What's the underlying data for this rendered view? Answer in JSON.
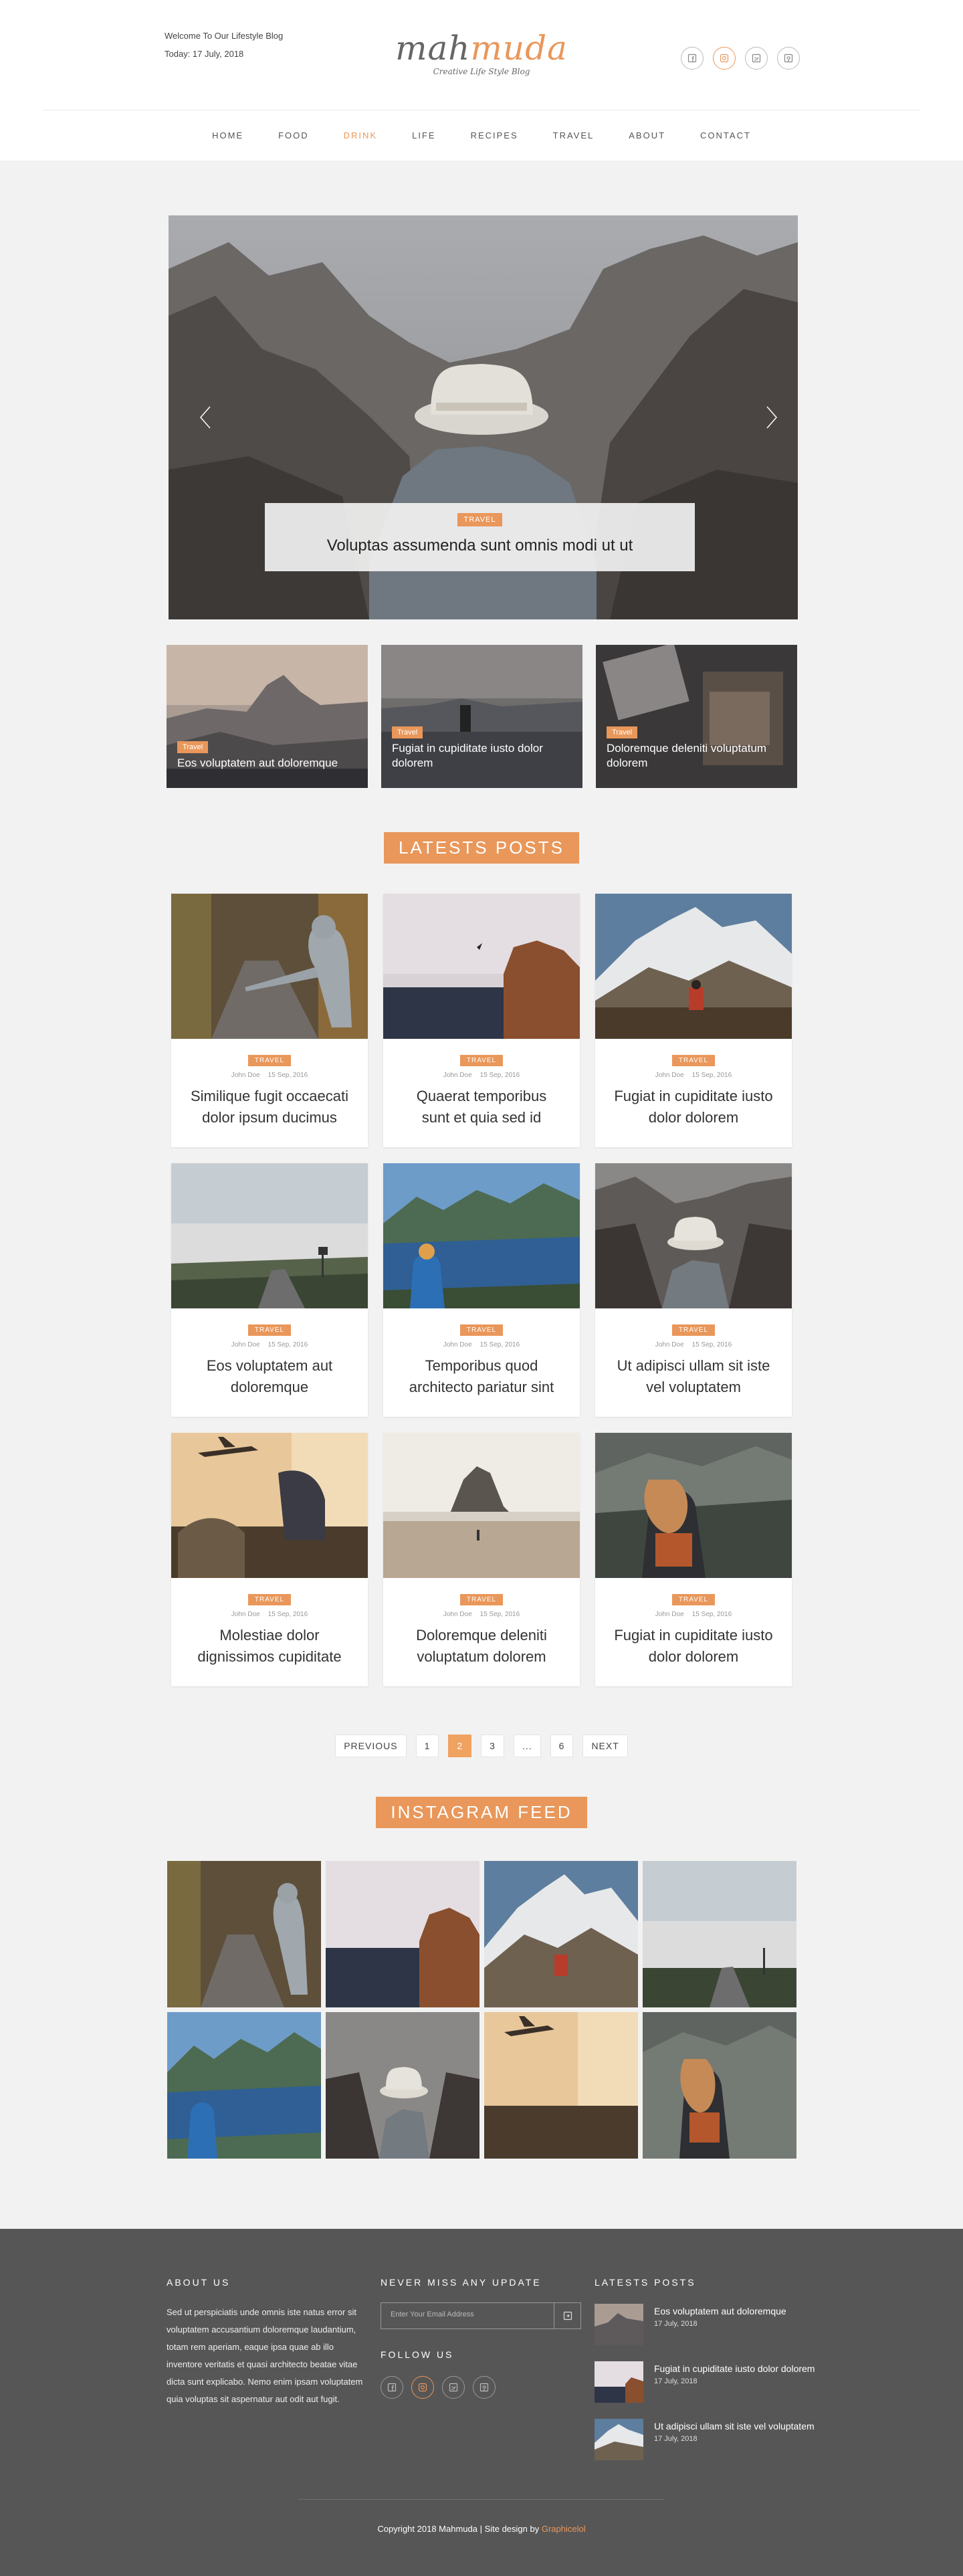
{
  "header": {
    "welcome": "Welcome To Our Lifestyle Blog",
    "today": "Today: 17 July, 2018",
    "logo_main_a": "mah",
    "logo_main_b": "muda",
    "logo_tagline": "Creative Life Style Blog",
    "socials": [
      "facebook-icon",
      "instagram-icon",
      "twitter-icon",
      "pinterest-icon"
    ],
    "accent_color": "#e9975a"
  },
  "nav": {
    "items": [
      "HOME",
      "FOOD",
      "DRINK",
      "LIFE",
      "RECIPES",
      "TRAVEL",
      "ABOUT",
      "CONTACT"
    ],
    "active": "DRINK"
  },
  "hero": {
    "tag": "TRAVEL",
    "title": "Voluptas assumenda sunt omnis modi ut ut"
  },
  "featured": [
    {
      "tag": "Travel",
      "title": "Eos voluptatem aut doloremque"
    },
    {
      "tag": "Travel",
      "title": "Fugiat in cupiditate iusto dolor dolorem"
    },
    {
      "tag": "Travel",
      "title": "Doloremque deleniti voluptatum dolorem"
    }
  ],
  "latest_heading": "LATESTS POSTS",
  "posts": [
    {
      "tag": "TRAVEL",
      "author": "John Doe",
      "date": "15 Sep, 2016",
      "title": "Similique fugit occaecati dolor ipsum ducimus"
    },
    {
      "tag": "TRAVEL",
      "author": "John Doe",
      "date": "15 Sep, 2016",
      "title": "Quaerat temporibus sunt et quia sed id"
    },
    {
      "tag": "TRAVEL",
      "author": "John Doe",
      "date": "15 Sep, 2016",
      "title": "Fugiat in cupiditate iusto dolor dolorem"
    },
    {
      "tag": "TRAVEL",
      "author": "John Doe",
      "date": "15 Sep, 2016",
      "title": "Eos voluptatem aut doloremque"
    },
    {
      "tag": "TRAVEL",
      "author": "John Doe",
      "date": "15 Sep, 2016",
      "title": "Temporibus quod architecto pariatur sint"
    },
    {
      "tag": "TRAVEL",
      "author": "John Doe",
      "date": "15 Sep, 2016",
      "title": "Ut adipisci ullam sit iste vel voluptatem"
    },
    {
      "tag": "TRAVEL",
      "author": "John Doe",
      "date": "15 Sep, 2016",
      "title": "Molestiae dolor dignissimos cupiditate"
    },
    {
      "tag": "TRAVEL",
      "author": "John Doe",
      "date": "15 Sep, 2016",
      "title": "Doloremque deleniti voluptatum dolorem"
    },
    {
      "tag": "TRAVEL",
      "author": "John Doe",
      "date": "15 Sep, 2016",
      "title": "Fugiat in cupiditate iusto dolor dolorem"
    }
  ],
  "pagination": {
    "prev": "PREVIOUS",
    "pages": [
      "1",
      "2",
      "3",
      "...",
      "6"
    ],
    "current": "2",
    "next": "NEXT"
  },
  "instagram_heading": "INSTAGRAM FEED",
  "footer": {
    "about_heading": "ABOUT US",
    "about_text": "Sed ut perspiciatis unde omnis iste natus error sit voluptatem accusantium doloremque laudantium, totam rem aperiam, eaque ipsa quae ab illo inventore veritatis et quasi architecto beatae vitae dicta sunt explicabo. Nemo enim ipsam voluptatem quia voluptas sit aspernatur aut odit aut fugit.",
    "update_heading": "NEVER MISS ANY UPDATE",
    "email_placeholder": "Enter Your Email Address",
    "follow_heading": "FOLLOW US",
    "latest_heading": "LATESTS POSTS",
    "latest_posts": [
      {
        "title": "Eos voluptatem aut doloremque",
        "date": "17 July, 2018"
      },
      {
        "title": "Fugiat in cupiditate iusto dolor dolorem",
        "date": "17 July, 2018"
      },
      {
        "title": "Ut adipisci ullam sit iste vel voluptatem",
        "date": "17 July, 2018"
      }
    ],
    "copyright": "Copyright 2018 Mahmuda | Site design by ",
    "designer": "Graphicelol"
  }
}
